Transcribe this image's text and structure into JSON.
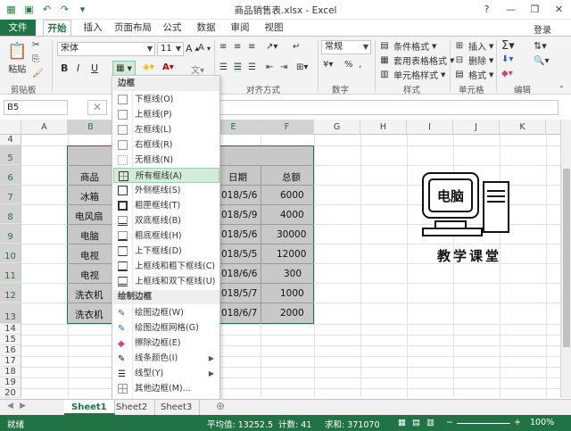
{
  "window": {
    "title": "商品销售表.xlsx - Excel"
  },
  "titlebar": {
    "min_label": "—",
    "restore_label": "❐",
    "close_label": "✕",
    "help_label": "?"
  },
  "tabs": [
    {
      "label": "文件"
    },
    {
      "label": "开始"
    },
    {
      "label": "插入"
    },
    {
      "label": "页面布局"
    },
    {
      "label": "公式"
    },
    {
      "label": "数据"
    },
    {
      "label": "审阅"
    },
    {
      "label": "视图"
    }
  ],
  "login_label": "登录",
  "ribbon": {
    "paste_label": "粘贴",
    "clipboard_label": "剪贴板",
    "font_name": "宋体",
    "font_size": "11",
    "bold": "B",
    "italic": "I",
    "underline": "U",
    "align_label": "对齐方式",
    "number_format": "常规",
    "number_label": "数字",
    "cond_format": "条件格式",
    "table_format": "套用表格格式",
    "cell_style": "单元格样式",
    "style_label": "样式",
    "insert_label": "插入",
    "delete_label": "删除",
    "format_label": "格式",
    "cells_label": "单元格",
    "edit_label": "编辑"
  },
  "formula_bar": {
    "name_box": "B5",
    "fx": "✕"
  },
  "columns": [
    "A",
    "B",
    "C",
    "D",
    "E",
    "F",
    "G",
    "H",
    "I",
    "J",
    "K"
  ],
  "rows": [
    "4",
    "5",
    "6",
    "7",
    "8",
    "9",
    "10",
    "11",
    "12",
    "13",
    "14",
    "15",
    "16",
    "17",
    "18",
    "19",
    "20",
    "21"
  ],
  "table": {
    "headers": {
      "product": "商品",
      "date": "日期",
      "total": "总额"
    },
    "rows": [
      {
        "product": "冰箱",
        "date": "018/5/6",
        "total": "6000"
      },
      {
        "product": "电风扇",
        "date": "018/5/9",
        "total": "4000"
      },
      {
        "product": "电脑",
        "date": "018/5/6",
        "total": "30000"
      },
      {
        "product": "电视",
        "date": "018/5/5",
        "total": "12000"
      },
      {
        "product": "电视",
        "date": "018/6/6",
        "total": "300"
      },
      {
        "product": "洗衣机",
        "date": "018/5/7",
        "total": "1000"
      },
      {
        "product": "洗衣机",
        "date": "018/6/7",
        "total": "2000"
      }
    ]
  },
  "menu": {
    "section1": "边框",
    "items1": [
      {
        "label": "下框线(O)"
      },
      {
        "label": "上框线(P)"
      },
      {
        "label": "左框线(L)"
      },
      {
        "label": "右框线(R)"
      },
      {
        "label": "无框线(N)"
      },
      {
        "label": "所有框线(A)",
        "highlighted": true
      },
      {
        "label": "外侧框线(S)"
      },
      {
        "label": "粗匣框线(T)"
      },
      {
        "label": "双底框线(B)"
      },
      {
        "label": "粗底框线(H)"
      },
      {
        "label": "上下框线(D)"
      },
      {
        "label": "上框线和粗下框线(C)"
      },
      {
        "label": "上框线和双下框线(U)"
      }
    ],
    "section2": "绘制边框",
    "items2": [
      {
        "label": "绘图边框(W)"
      },
      {
        "label": "绘图边框网格(G)"
      },
      {
        "label": "擦除边框(E)"
      },
      {
        "label": "线条颜色(I)",
        "submenu": true
      },
      {
        "label": "线型(Y)",
        "submenu": true
      },
      {
        "label": "其他边框(M)..."
      }
    ]
  },
  "logo": {
    "screen_text": "电脑",
    "caption": "教学课堂"
  },
  "sheets": [
    {
      "label": "Sheet1",
      "active": true
    },
    {
      "label": "Sheet2"
    },
    {
      "label": "Sheet3"
    }
  ],
  "status": {
    "ready": "就绪",
    "average": "平均值: 13252.5",
    "count": "计数: 41",
    "sum": "求和: 371070",
    "zoom": "100%"
  },
  "colors": {
    "accent": "#217346",
    "selection": "#c8c8c8",
    "highlight": "#d5ebd9",
    "arrow": "#e03030"
  }
}
